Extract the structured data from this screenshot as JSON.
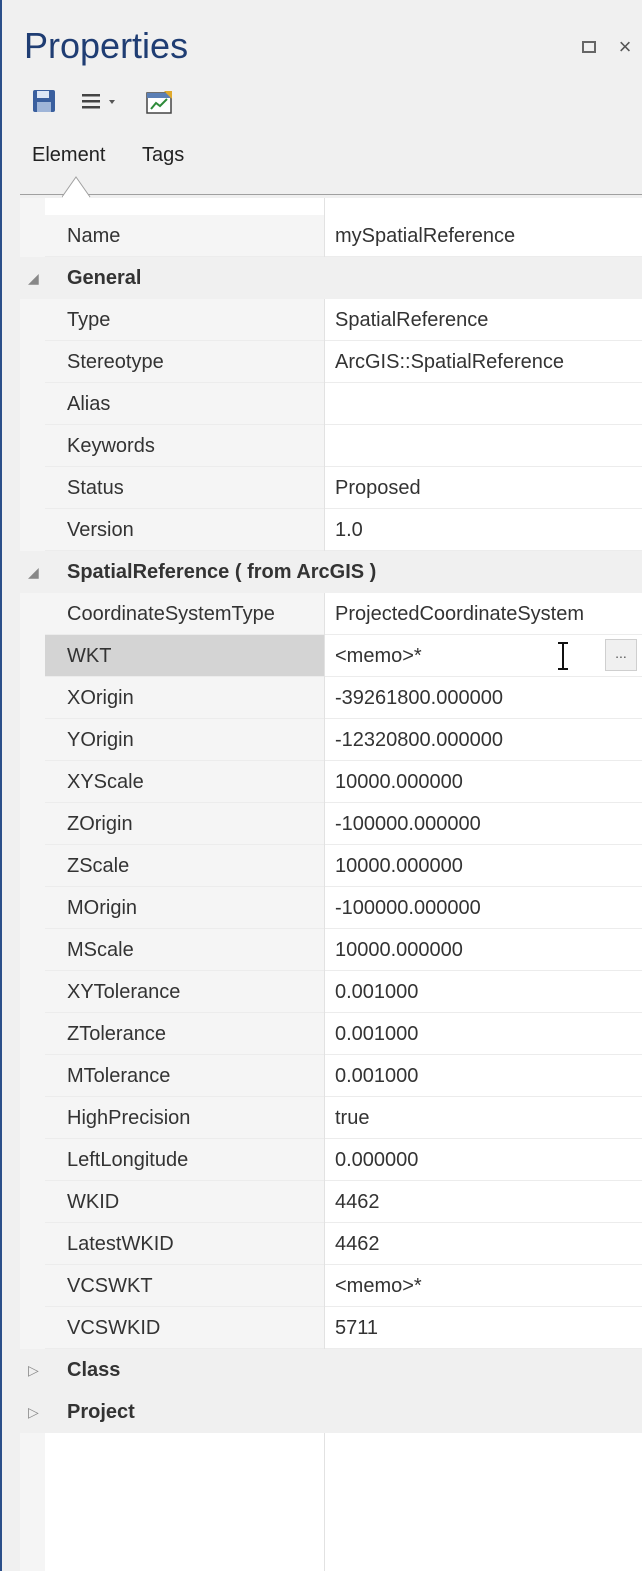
{
  "window": {
    "title": "Properties",
    "maximize_icon": "maximize-icon",
    "close_label": "×"
  },
  "toolbar": {
    "icons": [
      "save-icon",
      "menu-icon",
      "properties-icon"
    ]
  },
  "tabs": [
    {
      "label": "Element",
      "active": true
    },
    {
      "label": "Tags",
      "active": false
    }
  ],
  "grid": {
    "name_row": {
      "label": "Name",
      "value": "mySpatialReference"
    },
    "categories": [
      {
        "label": "General",
        "expanded": true,
        "rows": [
          {
            "label": "Type",
            "value": "SpatialReference"
          },
          {
            "label": "Stereotype",
            "value": "ArcGIS::SpatialReference"
          },
          {
            "label": "Alias",
            "value": ""
          },
          {
            "label": "Keywords",
            "value": ""
          },
          {
            "label": "Status",
            "value": "Proposed"
          },
          {
            "label": "Version",
            "value": "1.0"
          }
        ]
      },
      {
        "label": "SpatialReference  ( from ArcGIS )",
        "expanded": true,
        "rows": [
          {
            "label": "CoordinateSystemType",
            "value": "ProjectedCoordinateSystem"
          },
          {
            "label": "WKT",
            "value": "<memo>*",
            "selected": true,
            "ellipsis": "..."
          },
          {
            "label": "XOrigin",
            "value": "-39261800.000000"
          },
          {
            "label": "YOrigin",
            "value": "-12320800.000000"
          },
          {
            "label": "XYScale",
            "value": "10000.000000"
          },
          {
            "label": "ZOrigin",
            "value": "-100000.000000"
          },
          {
            "label": "ZScale",
            "value": "10000.000000"
          },
          {
            "label": "MOrigin",
            "value": "-100000.000000"
          },
          {
            "label": "MScale",
            "value": "10000.000000"
          },
          {
            "label": "XYTolerance",
            "value": "0.001000"
          },
          {
            "label": "ZTolerance",
            "value": "0.001000"
          },
          {
            "label": "MTolerance",
            "value": "0.001000"
          },
          {
            "label": "HighPrecision",
            "value": "true"
          },
          {
            "label": "LeftLongitude",
            "value": "0.000000"
          },
          {
            "label": "WKID",
            "value": "4462"
          },
          {
            "label": "LatestWKID",
            "value": "4462"
          },
          {
            "label": "VCSWKT",
            "value": "<memo>*"
          },
          {
            "label": "VCSWKID",
            "value": "5711"
          }
        ]
      },
      {
        "label": "Class",
        "expanded": false,
        "rows": []
      },
      {
        "label": "Project",
        "expanded": false,
        "rows": []
      }
    ]
  },
  "colors": {
    "title": "#1f3d73",
    "panel_bg": "#f0f0f0",
    "selected_row": "#d4d4d4"
  }
}
